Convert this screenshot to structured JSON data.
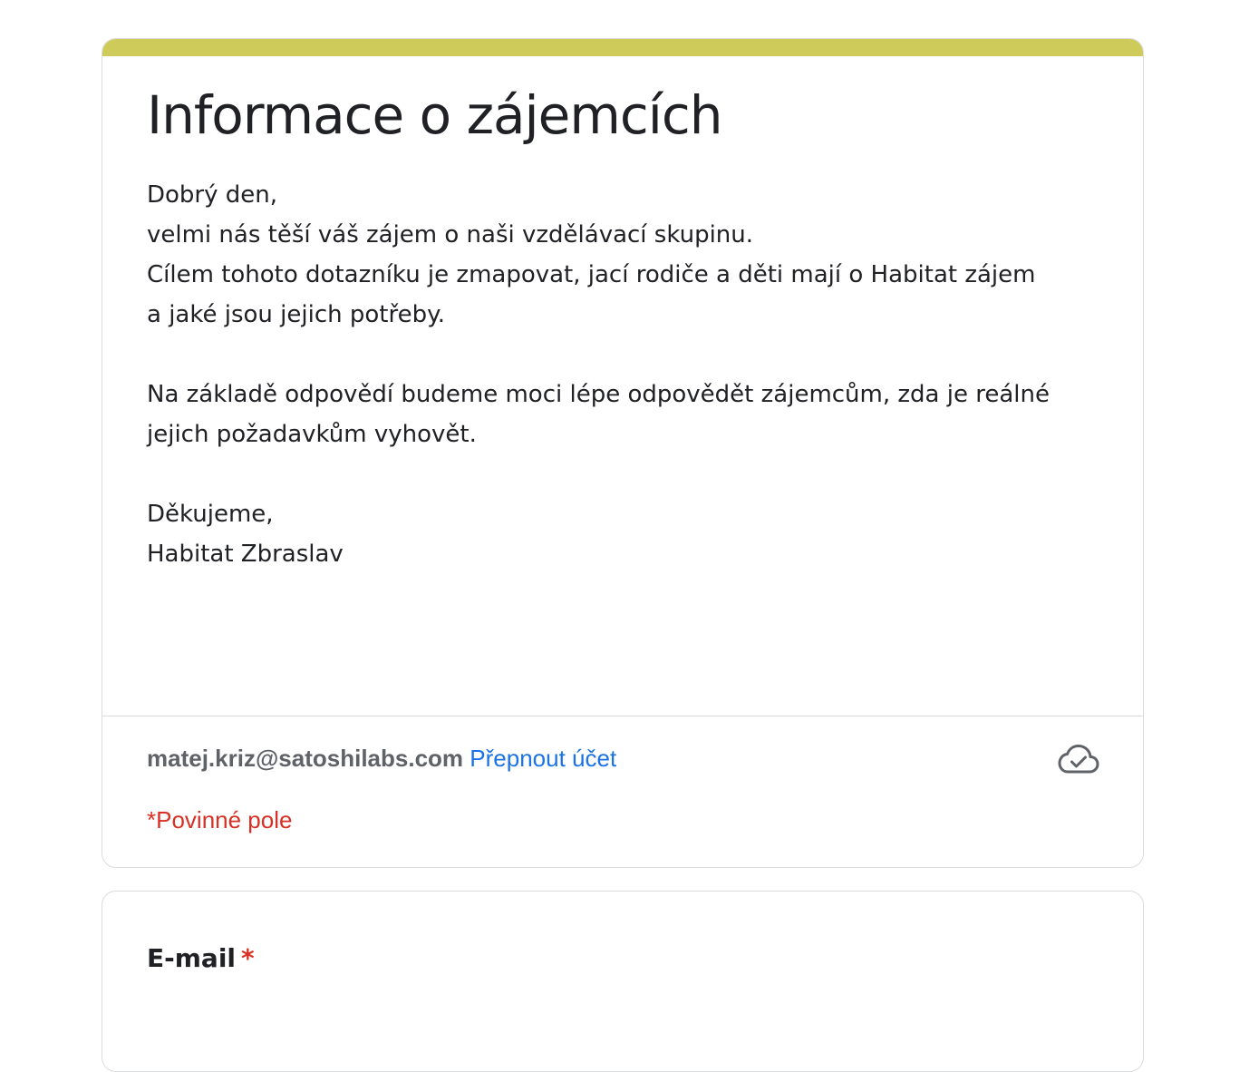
{
  "colors": {
    "accent": "#cfcb5b",
    "link": "#1a73e8",
    "required": "#d93025",
    "muted_text": "#5f6368"
  },
  "form": {
    "title": "Informace o zájemcích",
    "description": {
      "line1": "Dobrý den,",
      "line2": "velmi nás těší váš zájem o naši vzdělávací skupinu.",
      "line3": "Cílem tohoto dotazníku je zmapovat, jací rodiče a děti mají o Habitat zájem",
      "line4": "a jaké jsou jejich potřeby.",
      "line5": "Na základě odpovědí budeme moci lépe odpovědět zájemcům, zda je reálné",
      "line6": "jejich požadavkům vyhovět.",
      "line7": "Děkujeme,",
      "line8": "Habitat Zbraslav"
    },
    "account": {
      "email": "matej.kriz@satoshilabs.com",
      "switch_label": "Přepnout účet",
      "status_icon": "cloud-done-icon"
    },
    "required_note": "*Povinné pole"
  },
  "questions": [
    {
      "label": "E-mail",
      "required_marker": "*"
    }
  ]
}
